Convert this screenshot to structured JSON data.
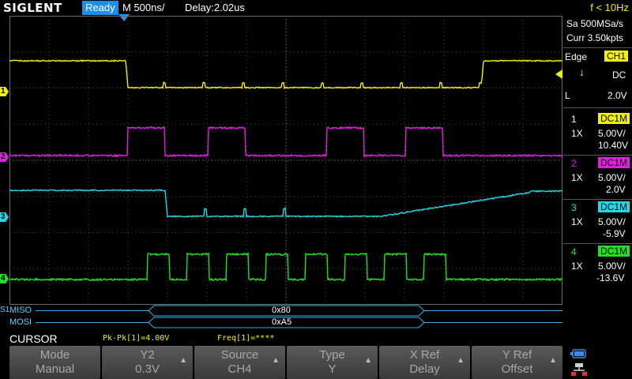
{
  "top": {
    "logo": "SIGLENT",
    "status": "Ready",
    "timebase": "M 500ns/",
    "delay": "Delay:2.02us",
    "frequency": "f < 10Hz"
  },
  "acquisition": {
    "sample_rate": "Sa 500MSa/s",
    "memory": "Curr 3.50kpts"
  },
  "trigger": {
    "type": "Edge",
    "source": "CH1",
    "coupling": "DC",
    "mode": "L",
    "level": "2.0V"
  },
  "channels": [
    {
      "num": "1",
      "coupling": "DC1M",
      "probe": "1X",
      "scale": "5.00V/",
      "offset": "10.40V",
      "color": "#f2f200"
    },
    {
      "num": "2",
      "coupling": "DC1M",
      "probe": "1X",
      "scale": "5.00V/",
      "offset": "2.0V",
      "color": "#e020e0"
    },
    {
      "num": "3",
      "coupling": "DC1M",
      "probe": "1X",
      "scale": "5.00V/",
      "offset": "-5.9V",
      "color": "#20d8e8"
    },
    {
      "num": "4",
      "coupling": "DC1M",
      "probe": "1X",
      "scale": "5.00V/",
      "offset": "-13.6V",
      "color": "#20e020"
    }
  ],
  "decode": {
    "marker": "S1",
    "rows": [
      {
        "label": "MISO",
        "value": "0x80"
      },
      {
        "label": "MOSI",
        "value": "0xA5"
      }
    ]
  },
  "cursor": {
    "title": "CURSOR",
    "pkpk": "Pk-Pk[1]=4.00V",
    "freq": "Freq[1]=****"
  },
  "softkeys": [
    {
      "title": "Mode",
      "value": "Manual",
      "arrow": ""
    },
    {
      "title": "Y2",
      "value": "0.3V",
      "arrow": "▲"
    },
    {
      "title": "Source",
      "value": "CH4",
      "arrow": "▲"
    },
    {
      "title": "Type",
      "value": "Y",
      "arrow": "▲"
    },
    {
      "title": "X Ref",
      "value": "Delay",
      "arrow": "▲"
    },
    {
      "title": "Y Ref",
      "value": "Offset",
      "arrow": "▲"
    }
  ],
  "icons": {
    "battery": "battery-icon",
    "network": "network-icon"
  }
}
